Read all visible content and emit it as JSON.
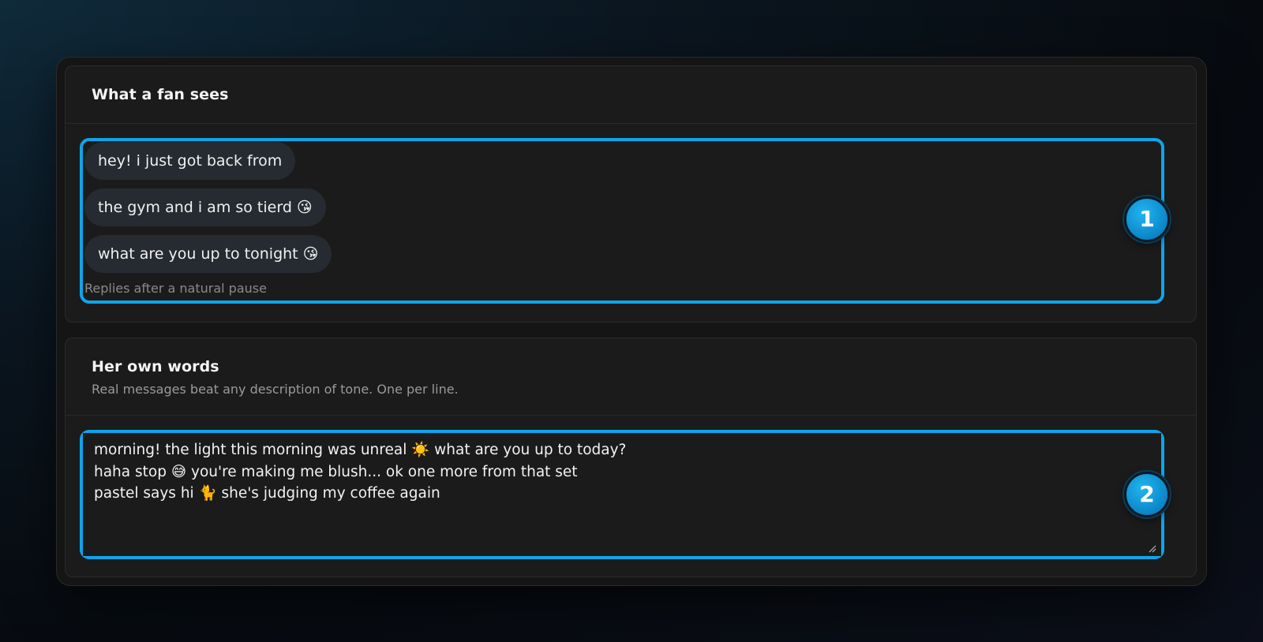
{
  "fan_preview": {
    "title": "What a fan sees",
    "bubbles": [
      "hey! i just got back from",
      "the gym and i am so tierd 😘",
      "what are you up to tonight 😘"
    ],
    "hint": "Replies after a natural pause",
    "badge": "1"
  },
  "own_words": {
    "title": "Her own words",
    "subtitle": "Real messages beat any description of tone. One per line.",
    "textarea_value": "morning! the light this morning was unreal ☀️ what are you up to today?\nhaha stop 😅 you're making me blush... ok one more from that set\npastel says hi 🐈 she's judging my coffee again",
    "badge": "2"
  },
  "colors": {
    "highlight": "#0ea5e9",
    "bubble_bg": "#252b31",
    "card_bg": "#1b1b1b"
  }
}
